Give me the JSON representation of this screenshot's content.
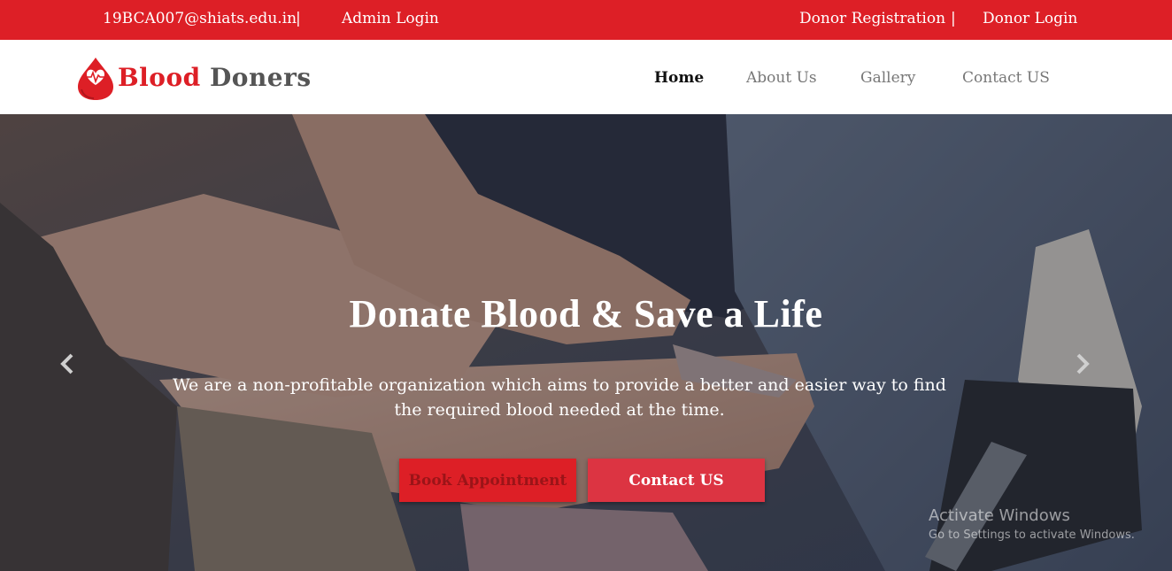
{
  "topbar": {
    "email": "19BCA007@shiats.edu.in",
    "separator": "|",
    "admin_login": "Admin Login",
    "donor_registration": "Donor Registration",
    "donor_login": "Donor Login"
  },
  "header": {
    "logo_word1": "Blood",
    "logo_word2": "Doners",
    "nav": {
      "home": "Home",
      "about": "About Us",
      "gallery": "Gallery",
      "contact": "Contact US"
    }
  },
  "hero": {
    "title": "Donate Blood & Save a Life",
    "subtitle": "We are a non-profitable organization which aims to provide a better and easier way to find the required blood needed at the time.",
    "book_button": "Book Appointment",
    "contact_button": "Contact US",
    "prev_icon": "chevron-left-icon",
    "next_icon": "chevron-right-icon"
  },
  "watermark": {
    "line1": "Activate Windows",
    "line2": "Go to Settings to activate Windows."
  },
  "colors": {
    "brand_red": "#dd1f26",
    "button_red": "#dc3442",
    "logo_gray": "#555555"
  }
}
